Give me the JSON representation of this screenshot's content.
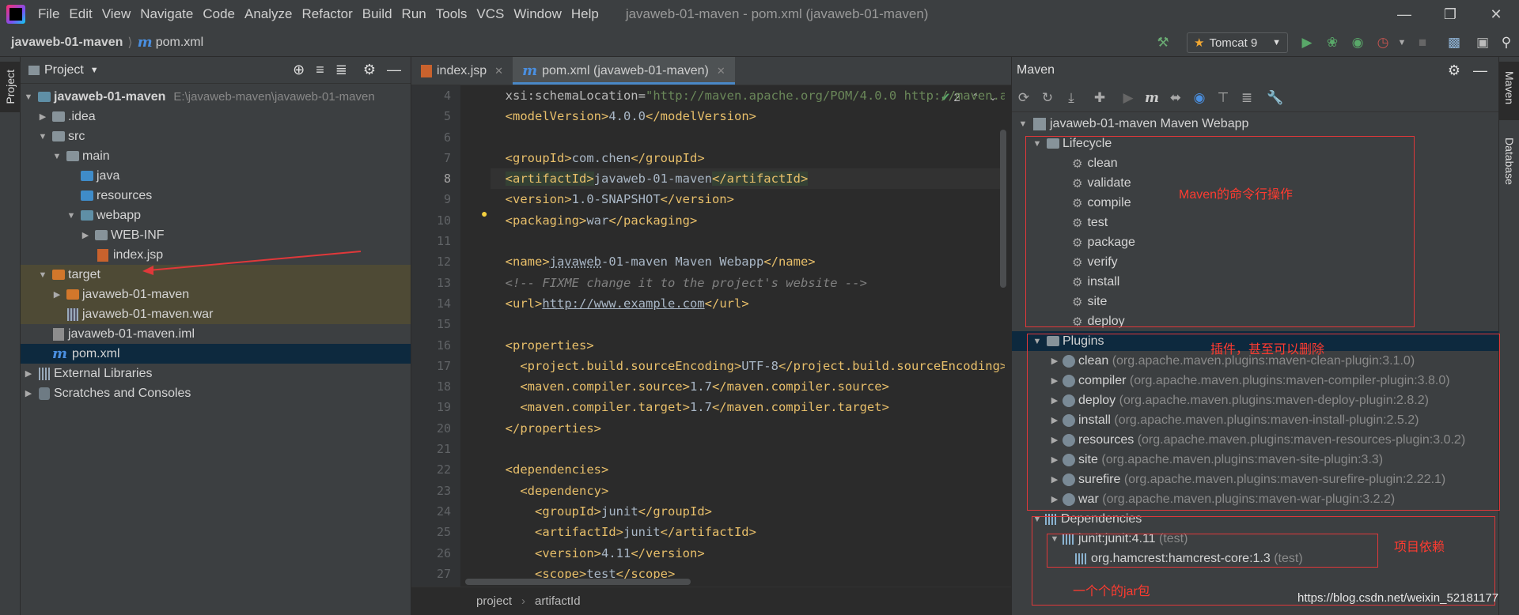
{
  "menu": [
    "File",
    "Edit",
    "View",
    "Navigate",
    "Code",
    "Analyze",
    "Refactor",
    "Build",
    "Run",
    "Tools",
    "VCS",
    "Window",
    "Help"
  ],
  "window_title": "javaweb-01-maven - pom.xml (javaweb-01-maven)",
  "breadcrumb": {
    "project": "javaweb-01-maven",
    "file": "pom.xml"
  },
  "run_config": "Tomcat 9",
  "left_strip": {
    "project_tab": "Project"
  },
  "right_strip": {
    "maven_tab": "Maven",
    "database_tab": "Database"
  },
  "project_panel": {
    "title": "Project",
    "tree": [
      {
        "label": "javaweb-01-maven",
        "path": "E:\\javaweb-maven\\javaweb-01-maven"
      },
      {
        "label": ".idea"
      },
      {
        "label": "src"
      },
      {
        "label": "main"
      },
      {
        "label": "java"
      },
      {
        "label": "resources"
      },
      {
        "label": "webapp"
      },
      {
        "label": "WEB-INF"
      },
      {
        "label": "index.jsp"
      },
      {
        "label": "target"
      },
      {
        "label": "javaweb-01-maven"
      },
      {
        "label": "javaweb-01-maven.war"
      },
      {
        "label": "javaweb-01-maven.iml"
      },
      {
        "label": "pom.xml"
      },
      {
        "label": "External Libraries"
      },
      {
        "label": "Scratches and Consoles"
      }
    ]
  },
  "editor": {
    "tabs": [
      {
        "label": "index.jsp"
      },
      {
        "label": "pom.xml (javaweb-01-maven)"
      }
    ],
    "inspection_count": "2",
    "line_numbers": [
      "4",
      "5",
      "6",
      "7",
      "8",
      "9",
      "10",
      "11",
      "12",
      "13",
      "14",
      "15",
      "16",
      "17",
      "18",
      "19",
      "20",
      "21",
      "22",
      "23",
      "24",
      "25",
      "26",
      "27"
    ],
    "status_breadcrumb": [
      "project",
      "artifactId"
    ]
  },
  "maven_panel": {
    "title": "Maven",
    "root": "javaweb-01-maven Maven Webapp",
    "lifecycle_label": "Lifecycle",
    "lifecycle": [
      "clean",
      "validate",
      "compile",
      "test",
      "package",
      "verify",
      "install",
      "site",
      "deploy"
    ],
    "plugins_label": "Plugins",
    "plugins": [
      {
        "name": "clean",
        "coord": "(org.apache.maven.plugins:maven-clean-plugin:3.1.0)"
      },
      {
        "name": "compiler",
        "coord": "(org.apache.maven.plugins:maven-compiler-plugin:3.8.0)"
      },
      {
        "name": "deploy",
        "coord": "(org.apache.maven.plugins:maven-deploy-plugin:2.8.2)"
      },
      {
        "name": "install",
        "coord": "(org.apache.maven.plugins:maven-install-plugin:2.5.2)"
      },
      {
        "name": "resources",
        "coord": "(org.apache.maven.plugins:maven-resources-plugin:3.0.2)"
      },
      {
        "name": "site",
        "coord": "(org.apache.maven.plugins:maven-site-plugin:3.3)"
      },
      {
        "name": "surefire",
        "coord": "(org.apache.maven.plugins:maven-surefire-plugin:2.22.1)"
      },
      {
        "name": "war",
        "coord": "(org.apache.maven.plugins:maven-war-plugin:3.2.2)"
      }
    ],
    "dependencies_label": "Dependencies",
    "dependencies": [
      {
        "name": "junit:junit:4.11",
        "scope": "(test)"
      },
      {
        "name": "org.hamcrest:hamcrest-core:1.3",
        "scope": "(test)"
      }
    ]
  },
  "annotations": {
    "lifecycle_note": "Maven的命令行操作",
    "plugins_note": "插件，甚至可以删除",
    "deps_note": "项目依赖",
    "jar_note": "一个个的jar包"
  },
  "watermark": "https://blog.csdn.net/weixin_52181177",
  "colors": {
    "accent": "#4a88c7",
    "annotation": "#e0383a",
    "background": "#2b2b2b",
    "panel": "#3c3f41"
  }
}
